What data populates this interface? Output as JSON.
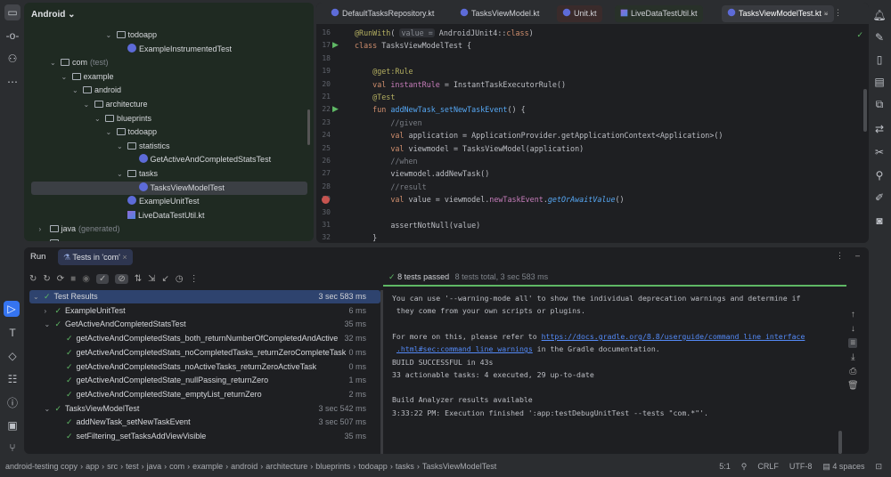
{
  "project": {
    "title": "Android",
    "rows": [
      {
        "label": "todoapp",
        "type": "folder",
        "indent": 7,
        "chev": "v"
      },
      {
        "label": "ExampleInstrumentedTest",
        "type": "class",
        "indent": 8
      },
      {
        "label": "com",
        "suffix": "(test)",
        "type": "folder",
        "indent": 2,
        "chev": "v"
      },
      {
        "label": "example",
        "type": "folder",
        "indent": 3,
        "chev": "v"
      },
      {
        "label": "android",
        "type": "folder",
        "indent": 4,
        "chev": "v"
      },
      {
        "label": "architecture",
        "type": "folder",
        "indent": 5,
        "chev": "v"
      },
      {
        "label": "blueprints",
        "type": "folder",
        "indent": 6,
        "chev": "v"
      },
      {
        "label": "todoapp",
        "type": "folder",
        "indent": 7,
        "chev": "v"
      },
      {
        "label": "statistics",
        "type": "folder",
        "indent": 8,
        "chev": "v"
      },
      {
        "label": "GetActiveAndCompletedStatsTest",
        "type": "class",
        "indent": 9
      },
      {
        "label": "tasks",
        "type": "folder",
        "indent": 8,
        "chev": "v"
      },
      {
        "label": "TasksViewModelTest",
        "type": "class",
        "indent": 9,
        "selected": true
      },
      {
        "label": "ExampleUnitTest",
        "type": "class",
        "indent": 8
      },
      {
        "label": "LiveDataTestUtil.kt",
        "type": "kt",
        "indent": 8
      },
      {
        "label": "java",
        "suffix": "(generated)",
        "type": "folder",
        "indent": 1,
        "chev": ">"
      },
      {
        "label": "res",
        "type": "folder",
        "indent": 1,
        "chev": "v"
      }
    ]
  },
  "tabs": [
    {
      "label": "DefaultTasksRepository.kt",
      "kind": "class"
    },
    {
      "label": "TasksViewModel.kt",
      "kind": "class"
    },
    {
      "label": "Unit.kt",
      "kind": "unit"
    },
    {
      "label": "LiveDataTestUtil.kt",
      "kind": "live"
    },
    {
      "label": "TasksViewModelTest.kt",
      "kind": "active"
    }
  ],
  "code": [
    {
      "n": "16",
      "html": "<span class='an'>@RunWith</span>( <span class='hint'>value =</span> AndroidJUnit4::<span class='kw'>class</span>)"
    },
    {
      "n": "17",
      "html": "<span class='kw'>class</span> TasksViewModelTest {",
      "gutter": "run"
    },
    {
      "n": "18",
      "html": ""
    },
    {
      "n": "19",
      "html": "    <span class='an'>@get:Rule</span>"
    },
    {
      "n": "20",
      "html": "    <span class='kw'>val</span> <span class='pr'>instantRule</span> = InstantTaskExecutorRule()"
    },
    {
      "n": "21",
      "html": "    <span class='an'>@Test</span>"
    },
    {
      "n": "22",
      "html": "    <span class='kw'>fun</span> <span class='fn'>addNewTask_setNewTaskEvent</span>() {",
      "gutter": "run"
    },
    {
      "n": "23",
      "html": "        <span class='cm'>//given</span>"
    },
    {
      "n": "24",
      "html": "        <span class='kw'>val</span> application = ApplicationProvider.getApplicationContext&lt;Application&gt;()"
    },
    {
      "n": "25",
      "html": "        <span class='kw'>val</span> viewmodel = TasksViewModel(application)"
    },
    {
      "n": "26",
      "html": "        <span class='cm'>//when</span>"
    },
    {
      "n": "27",
      "html": "        viewmodel.addNewTask()"
    },
    {
      "n": "28",
      "html": "        <span class='cm'>//result</span>"
    },
    {
      "n": "29",
      "html": "        <span class='kw'>val</span> value = viewmodel.<span class='pr'>newTaskEvent</span>.<span class='it'>getOrAwaitValue</span>()",
      "gutter": "breakpoint"
    },
    {
      "n": "30",
      "html": ""
    },
    {
      "n": "31",
      "html": "        assertNotNull(value)"
    },
    {
      "n": "32",
      "html": "    }"
    }
  ],
  "run": {
    "title": "Run",
    "tab": "Tests in 'com'"
  },
  "results": [
    {
      "label": "Test Results",
      "time": "3 sec 583 ms",
      "indent": 0,
      "chev": "v",
      "selected": true
    },
    {
      "label": "ExampleUnitTest",
      "time": "6 ms",
      "indent": 1,
      "chev": ">"
    },
    {
      "label": "GetActiveAndCompletedStatsTest",
      "time": "35 ms",
      "indent": 1,
      "chev": "v"
    },
    {
      "label": "getActiveAndCompletedStats_both_returnNumberOfCompletedAndActive",
      "time": "32 ms",
      "indent": 2
    },
    {
      "label": "getActiveAndCompletedStats_noCompletedTasks_returnZeroCompleteTask",
      "time": "0 ms",
      "indent": 2
    },
    {
      "label": "getActiveAndCompletedStats_noActiveTasks_returnZeroActiveTask",
      "time": "0 ms",
      "indent": 2
    },
    {
      "label": "getActiveAndCompletedState_nullPassing_returnZero",
      "time": "1 ms",
      "indent": 2
    },
    {
      "label": "getActiveAndCompletedState_emptyList_returnZero",
      "time": "2 ms",
      "indent": 2
    },
    {
      "label": "TasksViewModelTest",
      "time": "3 sec 542 ms",
      "indent": 1,
      "chev": "v"
    },
    {
      "label": "addNewTask_setNewTaskEvent",
      "time": "3 sec 507 ms",
      "indent": 2
    },
    {
      "label": "setFiltering_setTasksAddViewVisible",
      "time": "35 ms",
      "indent": 2
    }
  ],
  "summary": {
    "passed": "8 tests passed",
    "detail": "8 tests total, 3 sec 583 ms"
  },
  "console": [
    "You can use '--warning-mode all' to show the individual deprecation warnings and determine if",
    " they come from your own scripts or plugins.",
    "",
    "For more on this, please refer to ",
    "",
    "BUILD SUCCESSFUL in 43s",
    "33 actionable tasks: 4 executed, 29 up-to-date",
    "",
    "Build Analyzer results available",
    "3:33:22 PM: Execution finished ':app:testDebugUnitTest --tests \"com.*\"'."
  ],
  "link": {
    "part1": "https://docs.gradle.org/8.8/userguide/command_line_interface",
    "part2": ".html#sec:command_line_warnings",
    "after": " in the Gradle documentation."
  },
  "breadcrumb": [
    "android-testing copy",
    "app",
    "src",
    "test",
    "java",
    "com",
    "example",
    "android",
    "architecture",
    "blueprints",
    "todoapp",
    "tasks",
    "TasksViewModelTest"
  ],
  "status": {
    "position": "5:1",
    "line_sep": "CRLF",
    "encoding": "UTF-8",
    "indent": "4 spaces"
  },
  "colors": {
    "accent": "#3574f0",
    "success": "#5fb865"
  }
}
